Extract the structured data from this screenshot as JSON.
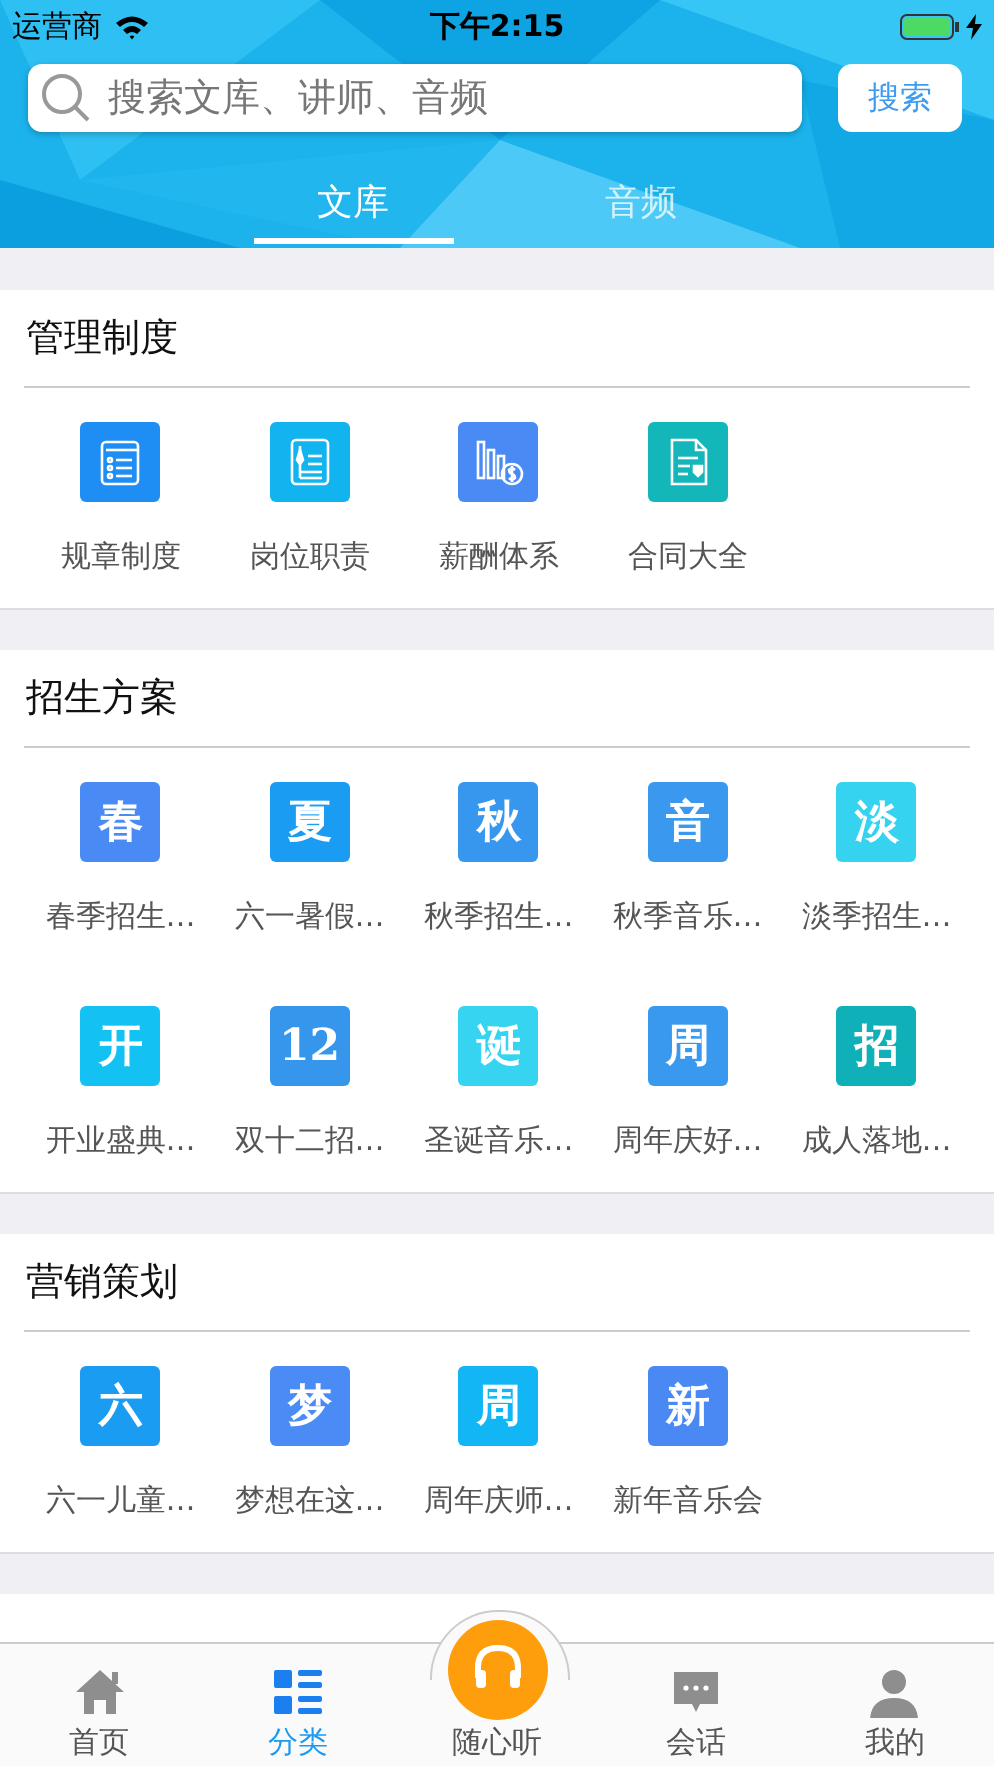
{
  "status_bar": {
    "carrier": "运营商",
    "time": "下午2:15"
  },
  "search": {
    "placeholder": "搜索文库、讲师、音频",
    "button": "搜索"
  },
  "tabs": [
    {
      "label": "文库",
      "selected": true
    },
    {
      "label": "音频",
      "selected": false
    }
  ],
  "sections": [
    {
      "title": "管理制度",
      "items": [
        {
          "kind": "rules",
          "color": "#1e8ef5",
          "label": "规章制度"
        },
        {
          "kind": "job",
          "color": "#12b4f0",
          "label": "岗位职责"
        },
        {
          "kind": "salary",
          "color": "#4a8af4",
          "label": "薪酬体系"
        },
        {
          "kind": "contract",
          "color": "#13b6b9",
          "label": "合同大全"
        }
      ]
    },
    {
      "title": "招生方案",
      "items": [
        {
          "kind": "glyph",
          "glyph": "春",
          "color": "#4a8af4",
          "label": "春季招生…"
        },
        {
          "kind": "glyph",
          "glyph": "夏",
          "color": "#1a9cf2",
          "label": "六一暑假…"
        },
        {
          "kind": "glyph",
          "glyph": "秋",
          "color": "#3797ee",
          "label": "秋季招生…"
        },
        {
          "kind": "glyph",
          "glyph": "音",
          "color": "#3a98ee",
          "label": "秋季音乐…"
        },
        {
          "kind": "glyph",
          "glyph": "淡",
          "color": "#35d3ef",
          "label": "淡季招生…"
        },
        {
          "kind": "glyph",
          "glyph": "开",
          "color": "#13c1f2",
          "label": "开业盛典…"
        },
        {
          "kind": "glyph",
          "glyph": "12",
          "color": "#3696ec",
          "label": "双十二招…"
        },
        {
          "kind": "glyph",
          "glyph": "诞",
          "color": "#36d4f0",
          "label": "圣诞音乐…"
        },
        {
          "kind": "glyph",
          "glyph": "周",
          "color": "#3999ef",
          "label": "周年庆好…"
        },
        {
          "kind": "glyph",
          "glyph": "招",
          "color": "#0fb0b8",
          "label": "成人落地…"
        }
      ]
    },
    {
      "title": "营销策划",
      "items": [
        {
          "kind": "glyph",
          "glyph": "六",
          "color": "#1a9cf3",
          "label": "六一儿童…"
        },
        {
          "kind": "glyph",
          "glyph": "梦",
          "color": "#4b8bf5",
          "label": "梦想在这…"
        },
        {
          "kind": "glyph",
          "glyph": "周",
          "color": "#12b6f5",
          "label": "周年庆师…"
        },
        {
          "kind": "glyph",
          "glyph": "新",
          "color": "#4a89f3",
          "label": "新年音乐会"
        }
      ]
    }
  ],
  "tab_bar": [
    {
      "kind": "home",
      "label": "首页",
      "selected": false
    },
    {
      "kind": "category",
      "label": "分类",
      "selected": true
    },
    {
      "kind": "listen",
      "label": "随心听",
      "selected": false
    },
    {
      "kind": "chat",
      "label": "会话",
      "selected": false
    },
    {
      "kind": "profile",
      "label": "我的",
      "selected": false
    }
  ]
}
